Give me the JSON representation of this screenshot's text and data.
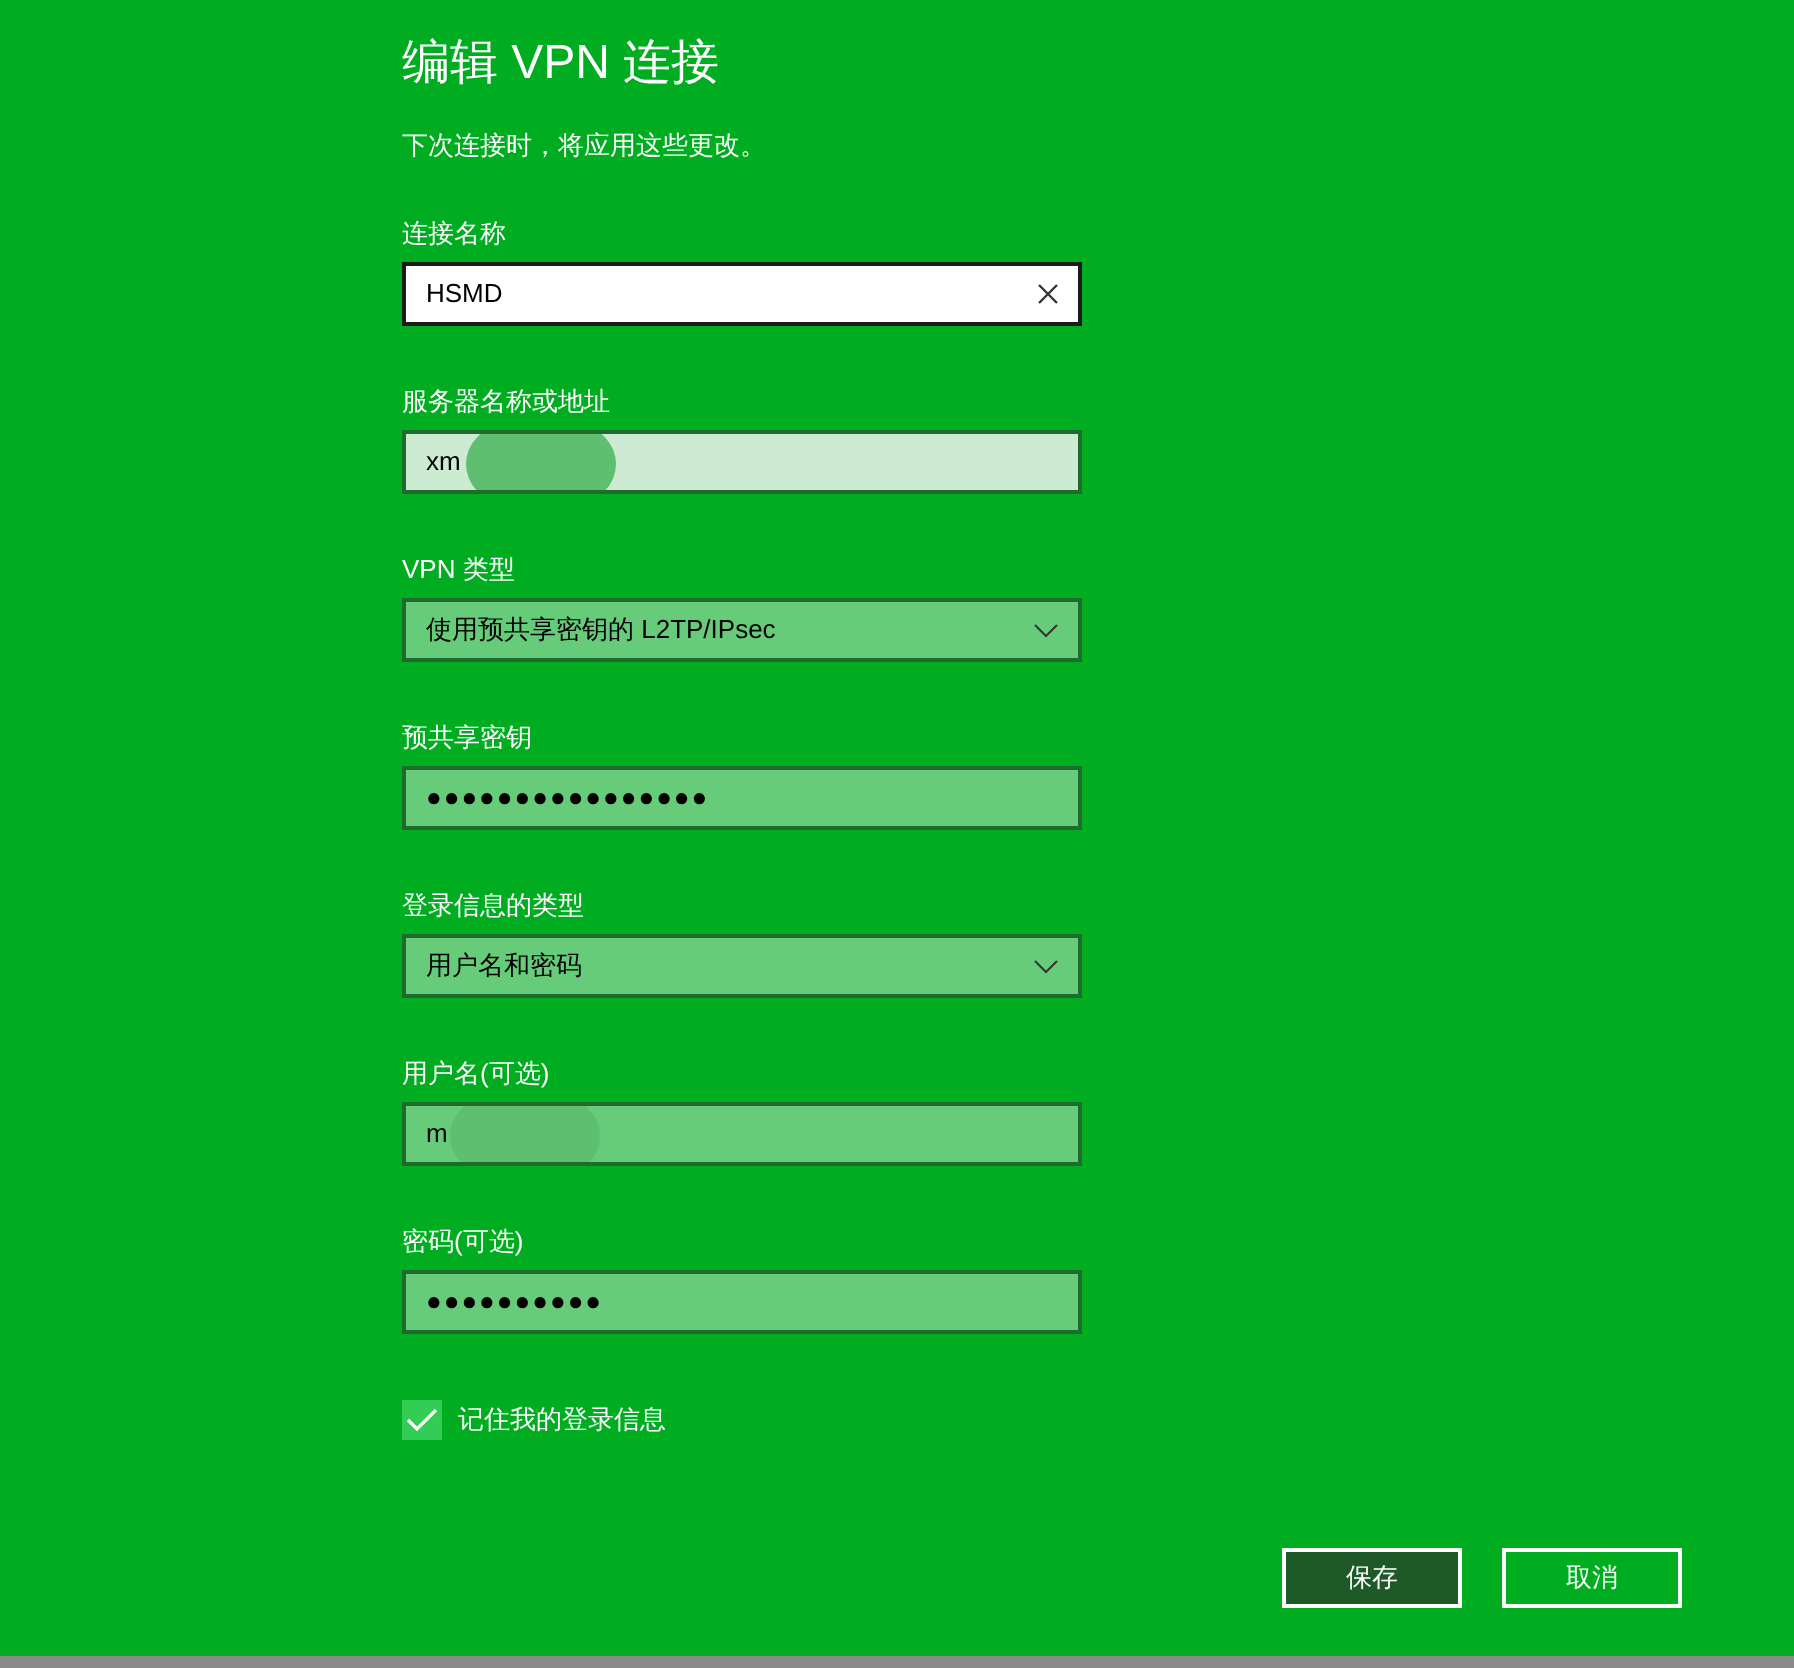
{
  "title": "编辑 VPN 连接",
  "subtitle": "下次连接时，将应用这些更改。",
  "fields": [
    {
      "kind": "text",
      "label": "连接名称",
      "value": "HSMD",
      "focused": true
    },
    {
      "kind": "text",
      "label": "服务器名称或地址",
      "value": "xm",
      "focused": false,
      "hovered": true,
      "redacted": true
    },
    {
      "kind": "dropdown",
      "label": "VPN 类型",
      "value": "使用预共享密钥的 L2TP/IPsec",
      "focused": false
    },
    {
      "kind": "password",
      "label": "预共享密钥",
      "value": "●●●●●●●●●●●●●●●●",
      "focused": false
    },
    {
      "kind": "dropdown",
      "label": "登录信息的类型",
      "value": "用户名和密码",
      "focused": false
    },
    {
      "kind": "text",
      "label": "用户名(可选)",
      "value": "m",
      "focused": false,
      "redacted": true
    },
    {
      "kind": "password",
      "label": "密码(可选)",
      "value": "●●●●●●●●●●",
      "focused": false
    }
  ],
  "remember": {
    "label": "记住我的登录信息",
    "checked": true
  },
  "buttons": [
    {
      "label": "保存",
      "primary": true
    },
    {
      "label": "取消",
      "primary": false
    }
  ]
}
